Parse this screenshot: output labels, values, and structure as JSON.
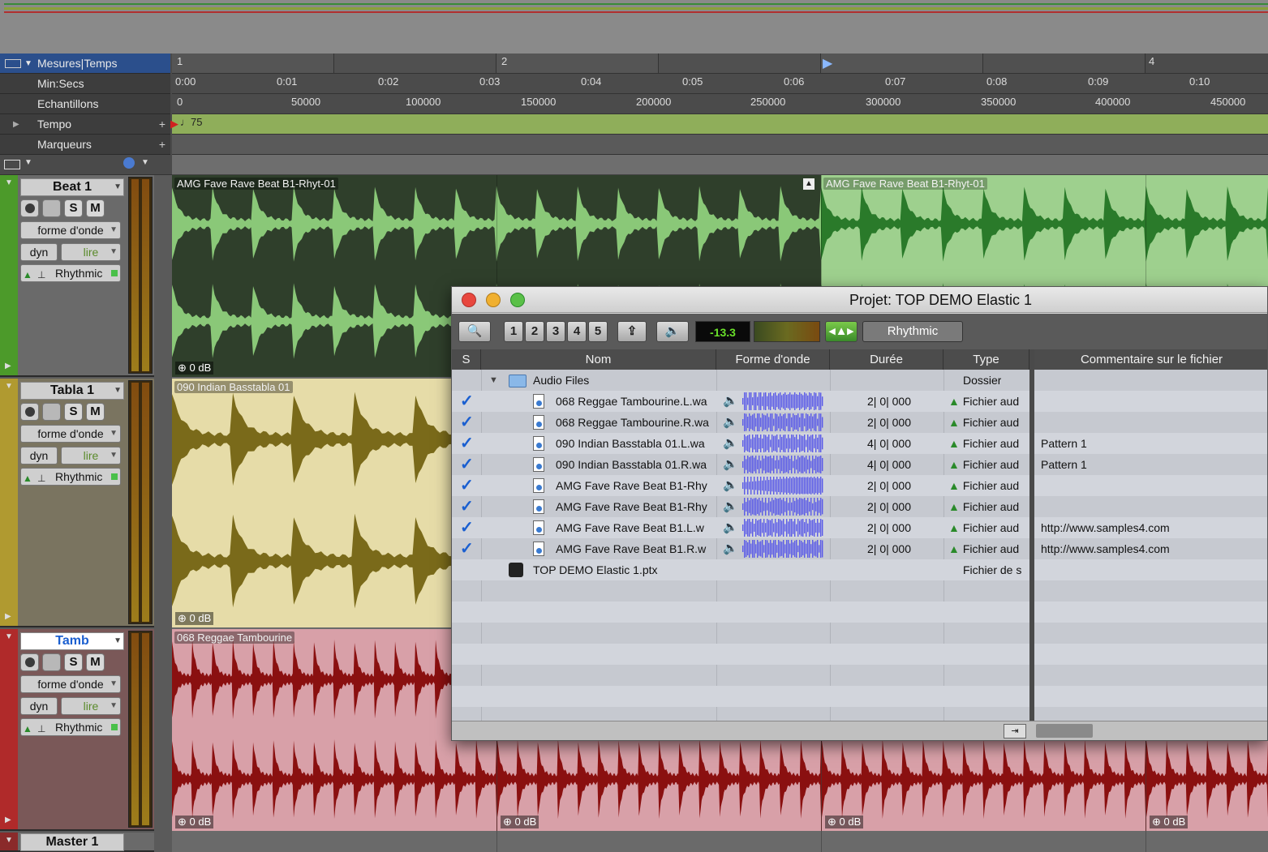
{
  "rulers": {
    "bars_label": "Mesures|Temps",
    "minsecs_label": "Min:Secs",
    "samples_label": "Echantillons",
    "tempo_label": "Tempo",
    "markers_label": "Marqueurs",
    "bars": [
      "1",
      "2",
      "",
      "4"
    ],
    "minsecs": [
      "0:00",
      "0:01",
      "0:02",
      "0:03",
      "0:04",
      "0:05",
      "0:06",
      "0:07",
      "0:08",
      "0:09",
      "0:10"
    ],
    "samples": [
      "0",
      "50000",
      "100000",
      "150000",
      "200000",
      "250000",
      "300000",
      "350000",
      "400000",
      "450000"
    ],
    "tempo_value": "♩75"
  },
  "tracks": [
    {
      "name": "Beat 1",
      "view": "forme d'onde",
      "dyn": "dyn",
      "mode": "lire",
      "elastic": "Rhythmic",
      "color": "#4c9a2a",
      "clips": [
        {
          "name": "AMG Fave Rave Beat B1-Rhyt-01",
          "gain": "0 dB"
        },
        {
          "name": "AMG Fave Rave Beat B1-Rhyt-01",
          "gain": ""
        }
      ]
    },
    {
      "name": "Tabla 1",
      "view": "forme d'onde",
      "dyn": "dyn",
      "mode": "lire",
      "elastic": "Rhythmic",
      "color": "#b09a30",
      "clips": [
        {
          "name": "090 Indian Basstabla 01",
          "gain": "0 dB"
        }
      ]
    },
    {
      "name": "Tamb",
      "view": "forme d'onde",
      "dyn": "dyn",
      "mode": "lire",
      "elastic": "Rhythmic",
      "color": "#b02a2a",
      "clips": [
        {
          "name": "068 Reggae Tambourine",
          "gain": "0 dB"
        },
        {
          "name": "",
          "gain": "0 dB"
        },
        {
          "name": "",
          "gain": "0 dB"
        },
        {
          "name": "",
          "gain": "0 dB"
        }
      ]
    },
    {
      "name": "Master 1"
    }
  ],
  "buttons": {
    "solo": "S",
    "mute": "M"
  },
  "project_window": {
    "title": "Projet: TOP DEMO Elastic 1",
    "toolbar": {
      "presets": [
        "1",
        "2",
        "3",
        "4",
        "5"
      ],
      "level": "-13.3",
      "elastic_mode": "Rhythmic"
    },
    "columns": {
      "s": "S",
      "name": "Nom",
      "waveform": "Forme d'onde",
      "duration": "Durée",
      "type": "Type",
      "comment": "Commentaire sur le fichier"
    },
    "folder": {
      "name": "Audio Files",
      "type": "Dossier"
    },
    "files": [
      {
        "name": "068 Reggae Tambourine.L.wa",
        "duration": "2| 0| 000",
        "type": "Fichier aud",
        "comment": ""
      },
      {
        "name": "068 Reggae Tambourine.R.wa",
        "duration": "2| 0| 000",
        "type": "Fichier aud",
        "comment": ""
      },
      {
        "name": "090 Indian Basstabla 01.L.wa",
        "duration": "4| 0| 000",
        "type": "Fichier aud",
        "comment": "Pattern 1"
      },
      {
        "name": "090 Indian Basstabla 01.R.wa",
        "duration": "4| 0| 000",
        "type": "Fichier aud",
        "comment": "Pattern 1"
      },
      {
        "name": "AMG Fave Rave Beat B1-Rhy",
        "duration": "2| 0| 000",
        "type": "Fichier aud",
        "comment": ""
      },
      {
        "name": "AMG Fave Rave Beat B1-Rhy",
        "duration": "2| 0| 000",
        "type": "Fichier aud",
        "comment": ""
      },
      {
        "name": "AMG Fave Rave Beat B1.L.w",
        "duration": "2| 0| 000",
        "type": "Fichier aud",
        "comment": "http://www.samples4.com"
      },
      {
        "name": "AMG Fave Rave Beat B1.R.w",
        "duration": "2| 0| 000",
        "type": "Fichier aud",
        "comment": "http://www.samples4.com"
      }
    ],
    "session_file": {
      "name": "TOP DEMO Elastic 1.ptx",
      "type": "Fichier de s"
    }
  }
}
